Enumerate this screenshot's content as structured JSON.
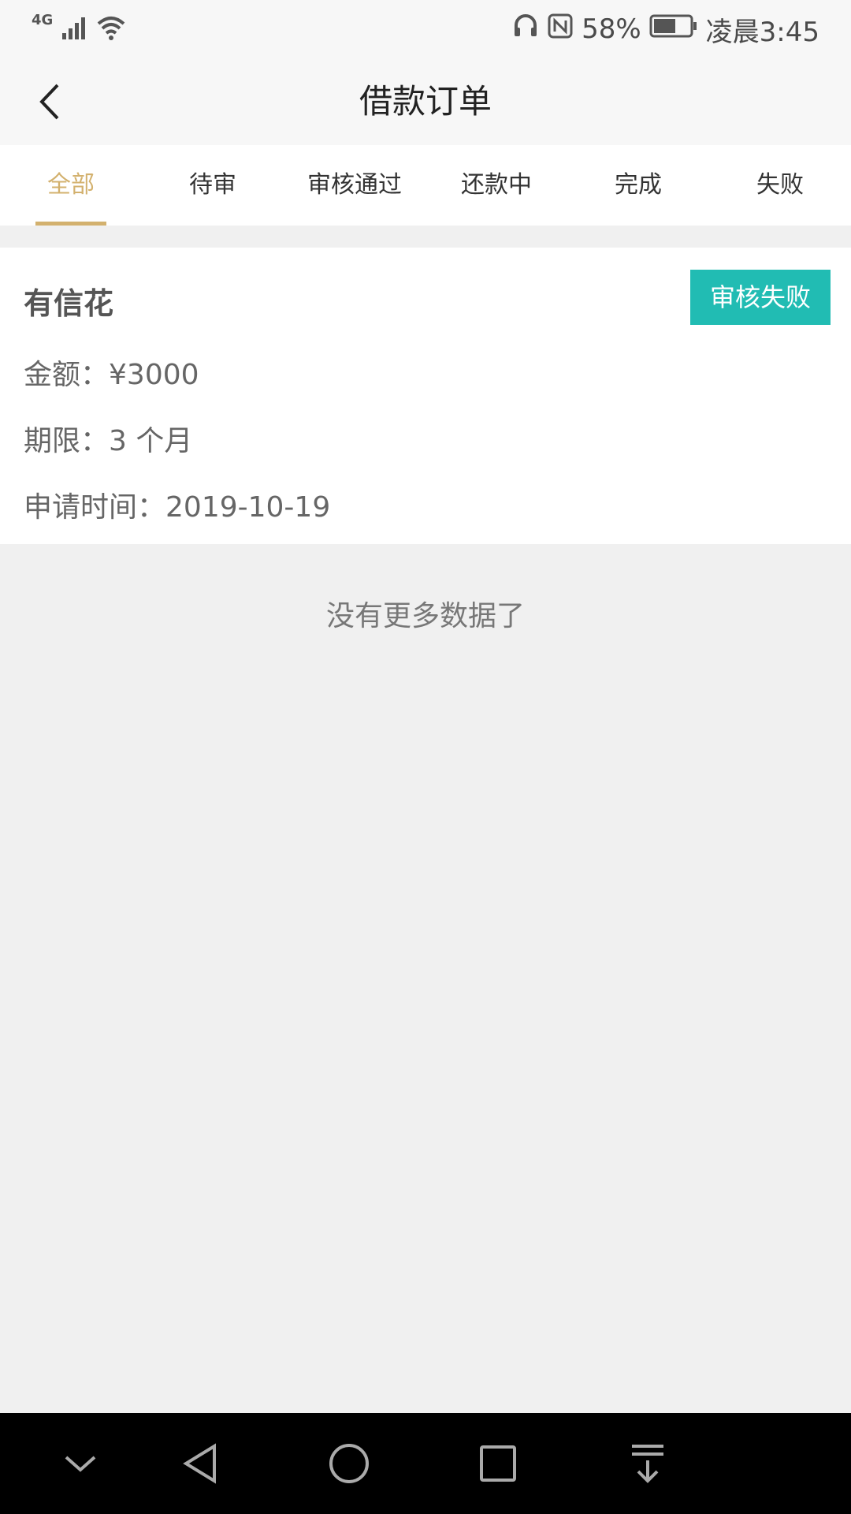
{
  "status_bar": {
    "network": "4G",
    "battery_percent": "58%",
    "time": "凌晨3:45"
  },
  "header": {
    "title": "借款订单"
  },
  "tabs": [
    {
      "label": "全部",
      "active": true
    },
    {
      "label": "待审",
      "active": false
    },
    {
      "label": "审核通过",
      "active": false
    },
    {
      "label": "还款中",
      "active": false
    },
    {
      "label": "完成",
      "active": false
    },
    {
      "label": "失败",
      "active": false
    }
  ],
  "order": {
    "name": "有信花",
    "status": "审核失败",
    "amount_label": "金额：",
    "amount_value": "¥3000",
    "term_label": "期限：",
    "term_value": "3 个月",
    "apply_time_label": "申请时间：",
    "apply_time_value": "2019-10-19"
  },
  "footer_text": "没有更多数据了",
  "colors": {
    "accent": "#d3b16e",
    "status_badge": "#21bcb3"
  }
}
